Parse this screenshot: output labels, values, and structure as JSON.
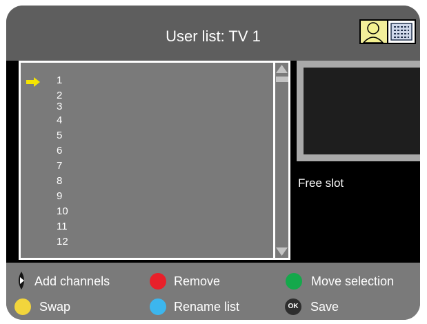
{
  "header": {
    "title": "User list: TV 1",
    "profile_icon": "user-list-icon"
  },
  "channel_list": {
    "items": [
      "1",
      "2",
      "3",
      "4",
      "5",
      "6",
      "7",
      "8",
      "9",
      "10",
      "11",
      "12"
    ],
    "selected_index": 0,
    "pointer_icon": "yellow-arrow-icon"
  },
  "preview": {
    "status_text": "Free slot"
  },
  "legend": {
    "add_channels": "Add channels",
    "remove": "Remove",
    "move_selection": "Move selection",
    "swap": "Swap",
    "rename_list": "Rename list",
    "ok_badge": "OK",
    "save": "Save"
  },
  "colors": {
    "red": "#e8202a",
    "green": "#14a84b",
    "yellow": "#f2d53c",
    "blue": "#3cb6ee",
    "pointer": "#f5e400"
  }
}
